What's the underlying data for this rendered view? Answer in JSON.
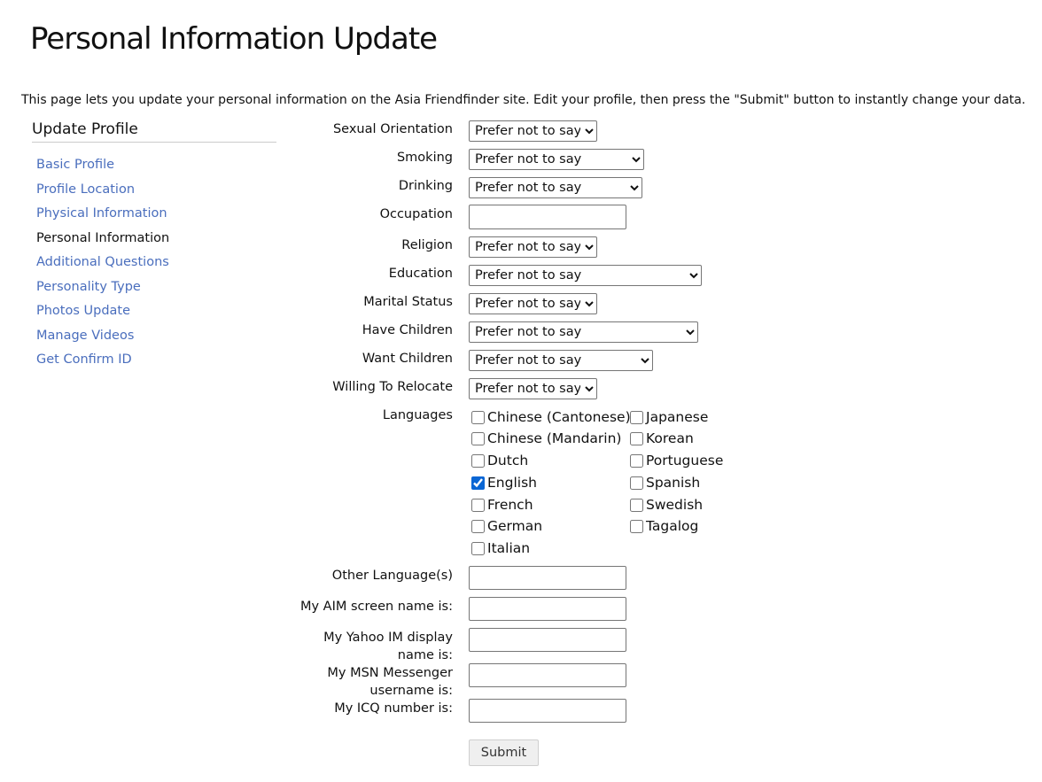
{
  "page": {
    "title": "Personal Information Update",
    "intro": "This page lets you update your personal information on the Asia Friendfinder site. Edit your profile, then press the \"Submit\" button to instantly change your data."
  },
  "sidebar": {
    "title": "Update Profile",
    "items": [
      {
        "label": "Basic Profile"
      },
      {
        "label": "Profile Location"
      },
      {
        "label": "Physical Information"
      },
      {
        "label": "Personal Information"
      },
      {
        "label": "Additional Questions"
      },
      {
        "label": "Personality Type"
      },
      {
        "label": "Photos Update"
      },
      {
        "label": "Manage Videos"
      },
      {
        "label": "Get Confirm ID"
      }
    ]
  },
  "form": {
    "sexual_orientation": {
      "label": "Sexual Orientation",
      "value": "Prefer not to say"
    },
    "smoking": {
      "label": "Smoking",
      "value": "Prefer not to say"
    },
    "drinking": {
      "label": "Drinking",
      "value": "Prefer not to say"
    },
    "occupation": {
      "label": "Occupation",
      "value": ""
    },
    "religion": {
      "label": "Religion",
      "value": "Prefer not to say"
    },
    "education": {
      "label": "Education",
      "value": "Prefer not to say"
    },
    "marital_status": {
      "label": "Marital Status",
      "value": "Prefer not to say"
    },
    "have_children": {
      "label": "Have Children",
      "value": "Prefer not to say"
    },
    "want_children": {
      "label": "Want Children",
      "value": "Prefer not to say"
    },
    "willing_to_relocate": {
      "label": "Willing To Relocate",
      "value": "Prefer not to say"
    },
    "languages": {
      "label": "Languages",
      "options": [
        {
          "label": "Chinese (Cantonese)",
          "checked": false
        },
        {
          "label": "Japanese",
          "checked": false
        },
        {
          "label": "Chinese (Mandarin)",
          "checked": false
        },
        {
          "label": "Korean",
          "checked": false
        },
        {
          "label": "Dutch",
          "checked": false
        },
        {
          "label": "Portuguese",
          "checked": false
        },
        {
          "label": "English",
          "checked": true
        },
        {
          "label": "Spanish",
          "checked": false
        },
        {
          "label": "French",
          "checked": false
        },
        {
          "label": "Swedish",
          "checked": false
        },
        {
          "label": "German",
          "checked": false
        },
        {
          "label": "Tagalog",
          "checked": false
        },
        {
          "label": "Italian",
          "checked": false
        }
      ]
    },
    "other_languages": {
      "label": "Other Language(s)",
      "value": ""
    },
    "aim": {
      "label": "My AIM screen name is:",
      "value": ""
    },
    "yahoo": {
      "label_line1": "My Yahoo IM display",
      "label_line2": "name is:",
      "value": ""
    },
    "msn": {
      "label_line1": "My MSN Messenger",
      "label_line2": "username is:",
      "value": ""
    },
    "icq": {
      "label": "My ICQ number is:",
      "value": ""
    },
    "submit_label": "Submit"
  },
  "colors": {
    "link": "#4a6ebd",
    "checkbox_accent": "#0a66d4"
  }
}
